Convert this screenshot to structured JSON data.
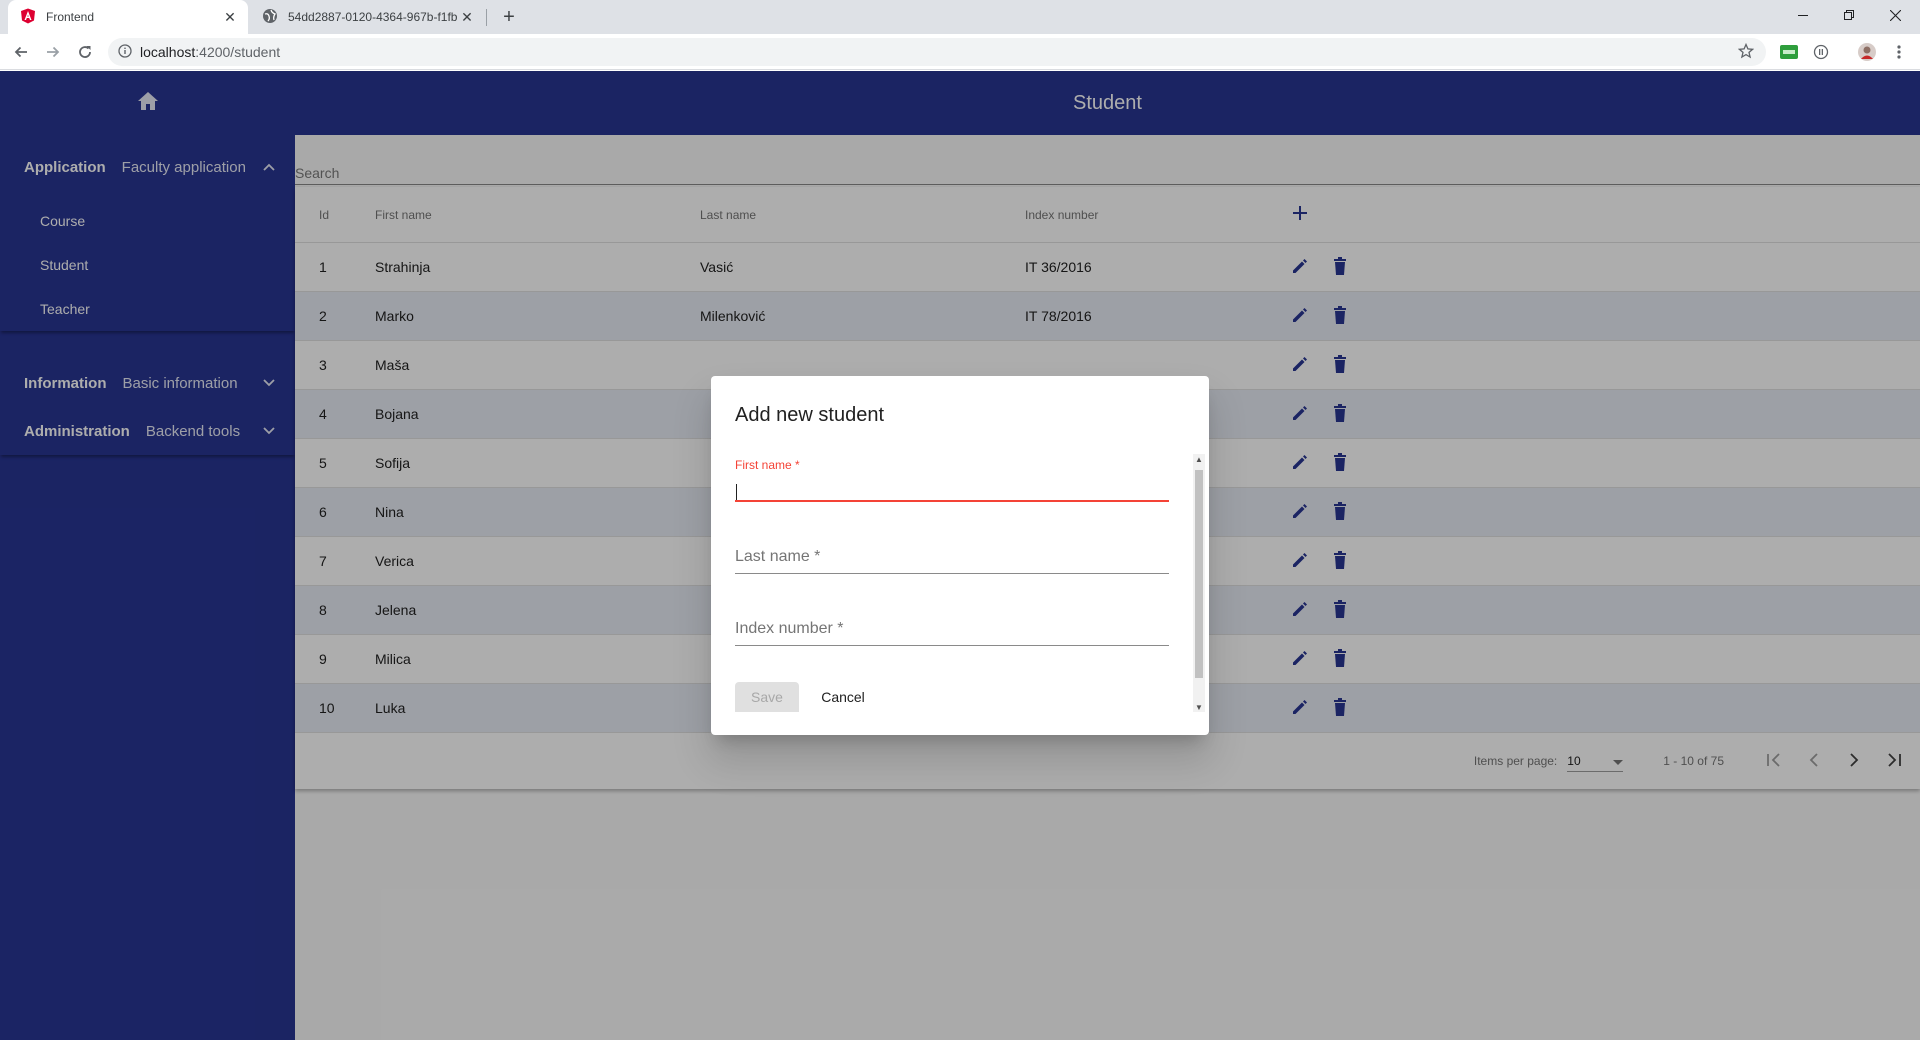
{
  "browser": {
    "tabs": [
      {
        "title": "Frontend",
        "icon": "angular-icon"
      },
      {
        "title": "54dd2887-0120-4364-967b-f1fb",
        "icon": "globe-icon"
      }
    ],
    "address": {
      "host": "localhost",
      "path": ":4200/student"
    }
  },
  "sidebar": {
    "sections": [
      {
        "title": "Application",
        "desc": "Faculty application",
        "expanded": true,
        "items": [
          "Course",
          "Student",
          "Teacher"
        ]
      },
      {
        "title": "Information",
        "desc": "Basic information",
        "expanded": false
      },
      {
        "title": "Administration",
        "desc": "Backend tools",
        "expanded": false
      }
    ]
  },
  "header": {
    "title": "Student"
  },
  "search": {
    "placeholder": "Search"
  },
  "table": {
    "columns": [
      "Id",
      "First name",
      "Last name",
      "Index number"
    ],
    "rows": [
      {
        "id": "1",
        "first": "Strahinja",
        "last": "Vasić",
        "index": "IT 36/2016"
      },
      {
        "id": "2",
        "first": "Marko",
        "last": "Milenković",
        "index": "IT 78/2016"
      },
      {
        "id": "3",
        "first": "Maša",
        "last": "",
        "index": ""
      },
      {
        "id": "4",
        "first": "Bojana",
        "last": "",
        "index": ""
      },
      {
        "id": "5",
        "first": "Sofija",
        "last": "",
        "index": ""
      },
      {
        "id": "6",
        "first": "Nina",
        "last": "",
        "index": ""
      },
      {
        "id": "7",
        "first": "Verica",
        "last": "",
        "index": ""
      },
      {
        "id": "8",
        "first": "Jelena",
        "last": "",
        "index": ""
      },
      {
        "id": "9",
        "first": "Milica",
        "last": "",
        "index": ""
      },
      {
        "id": "10",
        "first": "Luka",
        "last": "",
        "index": ""
      }
    ]
  },
  "paginator": {
    "items_per_page_label": "Items per page:",
    "items_per_page": "10",
    "range": "1 - 10 of 75"
  },
  "dialog": {
    "title": "Add new student",
    "first_name_label": "First name *",
    "last_name_label": "Last name *",
    "index_label": "Index number *",
    "save_label": "Save",
    "cancel_label": "Cancel"
  },
  "colors": {
    "primary": "#283593",
    "warn": "#f44336",
    "row_alt": "#e8ecf5"
  }
}
